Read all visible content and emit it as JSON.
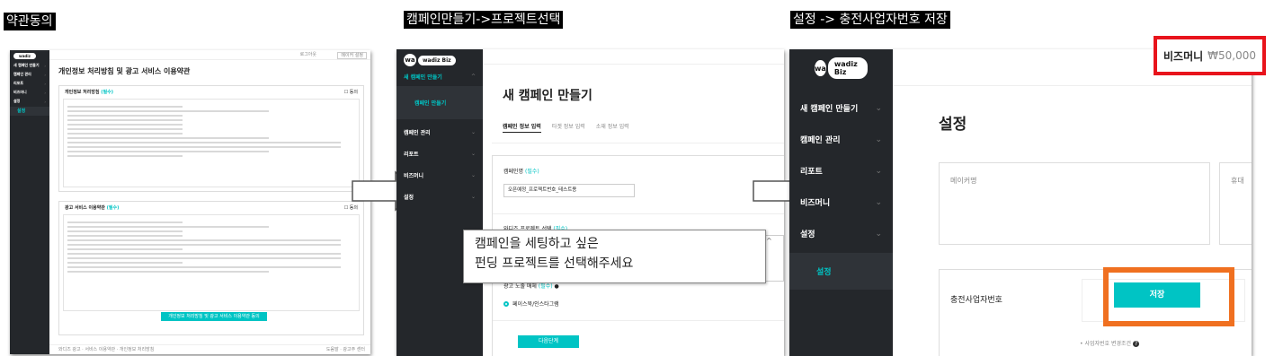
{
  "captions": {
    "step1": "약관동의",
    "step2": "캠페인만들기->프로젝트선택",
    "step3": "설정 -> 충전사업자번호 저장"
  },
  "panel1": {
    "logo": "wadiz",
    "nav": [
      {
        "label": "새 캠페인 만들기"
      },
      {
        "label": "캠페인 관리"
      },
      {
        "label": "리포트"
      },
      {
        "label": "비즈머니"
      },
      {
        "label": "설정"
      }
    ],
    "sub_item": "설정",
    "header_links": [
      "로그아웃",
      "메이커 설정"
    ],
    "title": "개인정보 처리방침 및 광고 서비스 이용약관",
    "section1_title": "개인정보 처리방침",
    "section1_badge": "(필수)",
    "section2_title": "광고 서비스 이용약관",
    "section2_badge": "(필수)",
    "agree_label": "동의",
    "agree_button": "개인정보 처리방침 및 광고 서비스 이용약관 동의",
    "footer_left": "와디즈 광고 · 서비스 이용약관 · 개인정보 처리방침",
    "footer_right": "도움말 · 광고주 센터"
  },
  "panel2": {
    "logo_wa": "wa",
    "logo_biz": "wadiz Biz",
    "nav_new": "새 캠페인 만들기",
    "sub_item": "캠페인 만들기",
    "nav": [
      {
        "label": "캠페인 관리"
      },
      {
        "label": "리포트"
      },
      {
        "label": "비즈머니"
      },
      {
        "label": "설정"
      }
    ],
    "title": "새 캠페인 만들기",
    "tabs": [
      "캠페인 정보 입력",
      "타겟 정보 입력",
      "소재 정보 입력"
    ],
    "campaign_name_label": "캠페인명",
    "campaign_name_required": "(필수)",
    "campaign_name_value": "오픈예정_프로젝트번호_테스트용",
    "project_label": "와디즈 프로젝트 선택",
    "project_required": "(필수)",
    "media_label": "광고 노출 매체",
    "media_required": "(필수)",
    "media_option": "페이스북/인스타그램",
    "next_button": "다음단계",
    "callout_line1": "캠페인을 세팅하고 싶은",
    "callout_line2": "펀딩 프로젝트를 선택해주세요"
  },
  "panel3": {
    "logo_wa": "wa",
    "logo_biz": "wadiz Biz",
    "nav": [
      {
        "label": "새 캠페인 만들기"
      },
      {
        "label": "캠페인 관리"
      },
      {
        "label": "리포트"
      },
      {
        "label": "비즈머니"
      },
      {
        "label": "설정"
      }
    ],
    "sub_item": "설정",
    "bizmoney_label": "비즈머니",
    "bizmoney_value": "₩50,000",
    "title": "설정",
    "maker_label": "메이커명",
    "right_cut_label": "휴대",
    "charge_label": "충전사업자번호",
    "save_button": "저장",
    "note": "사업자번호 변경조건"
  },
  "colors": {
    "sidebar": "#24272b",
    "accent": "#00c4c4",
    "highlight_red": "#e8141c",
    "highlight_orange": "#f07020"
  }
}
